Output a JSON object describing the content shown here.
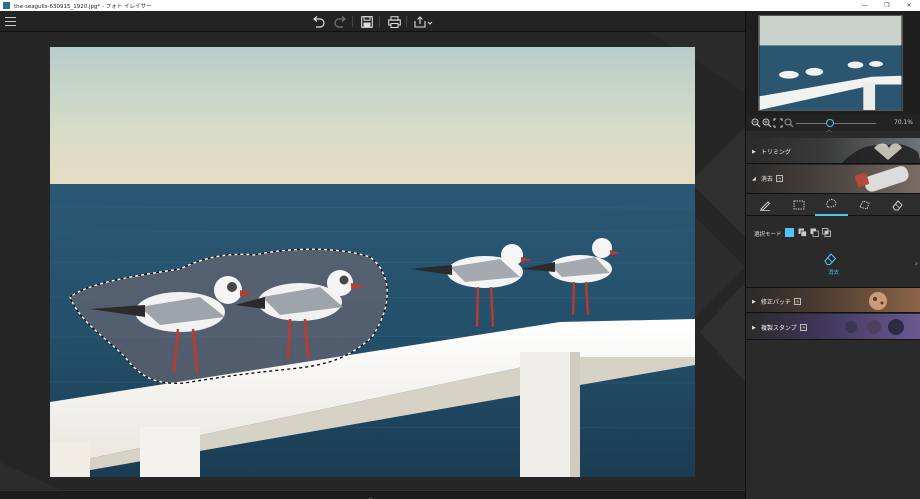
{
  "window": {
    "title": "the-seagulls-630915_1920.jpg* - フォト イレイサー",
    "minimize": "—",
    "maximize": "❐",
    "close": "✕"
  },
  "toolbar": {
    "menu": "menu",
    "undo": "undo",
    "redo": "redo",
    "save": "save",
    "print": "print",
    "share": "share"
  },
  "panel": {
    "zoom_value": "70.1%",
    "sections": {
      "trimming": "トリミング",
      "erase": "消去",
      "repair_patch": "修正パッチ",
      "clone_stamp": "複製スタンプ"
    },
    "selection_mode_label": "選択モード",
    "erase_button": "消去"
  },
  "colors": {
    "accent": "#4fc3f7",
    "background": "#1e1e1e",
    "panel": "#2a2a2a"
  }
}
